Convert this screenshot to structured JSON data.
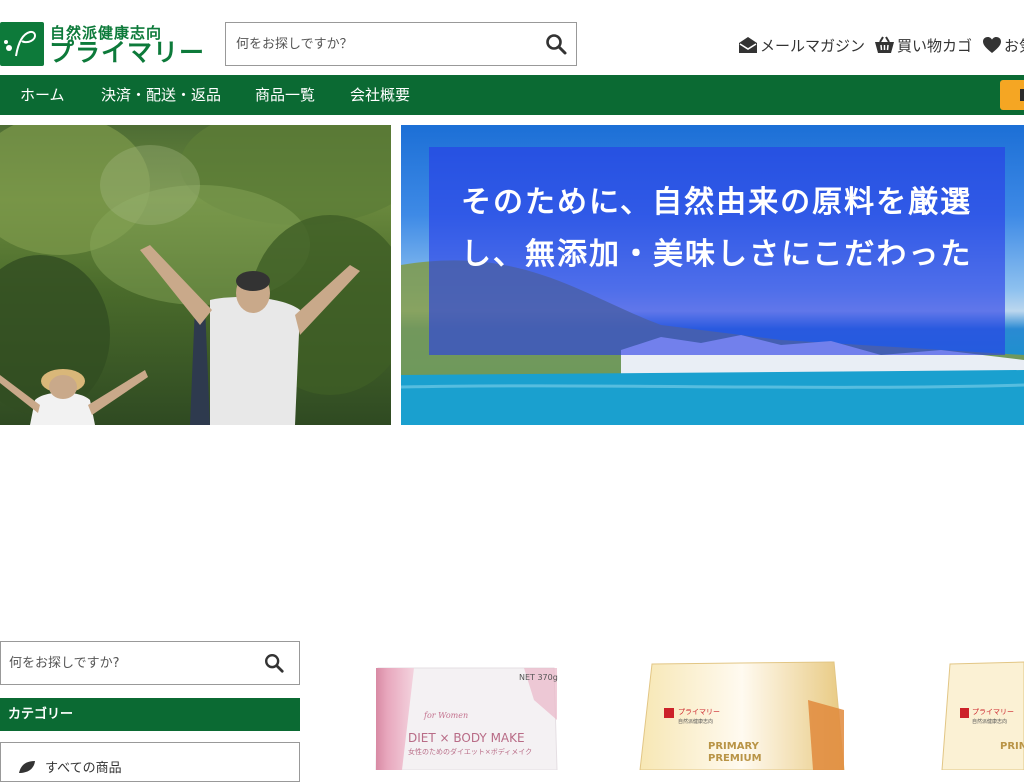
{
  "header": {
    "logo_sub": "自然派健康志向",
    "logo_main": "プライマリー",
    "search_placeholder": "何をお探しですか？",
    "links": {
      "mail": "メールマガジン",
      "cart": "買い物カゴ",
      "favorite": "お気"
    }
  },
  "nav": {
    "items": [
      "ホーム",
      "決済・配送・返品",
      "商品一覧",
      "会社概要"
    ]
  },
  "hero": {
    "caption": "そのために、自然由来の原料を厳選し、無添加・美味しさにこだわった"
  },
  "sidebar": {
    "search_placeholder": "何をお探しですか?",
    "category_title": "カテゴリー",
    "category_items": [
      "すべての商品"
    ]
  },
  "products": [
    {
      "brand": "for Women",
      "title": "DIET × BODY MAKE",
      "subtitle": "女性のためのダイエット×ボディメイク",
      "weight": "NET 370g"
    },
    {
      "brand": "プライマリー",
      "maker": "自然派健康志向",
      "title": "PRIMARY",
      "subtitle": "PREMIUM"
    },
    {
      "brand": "プライマリー",
      "maker": "自然派健康志向",
      "title": "PRIM"
    }
  ],
  "colors": {
    "brand_green": "#0b6a33",
    "accent_orange": "#f5a623",
    "caption_blue": "#2838e6"
  }
}
